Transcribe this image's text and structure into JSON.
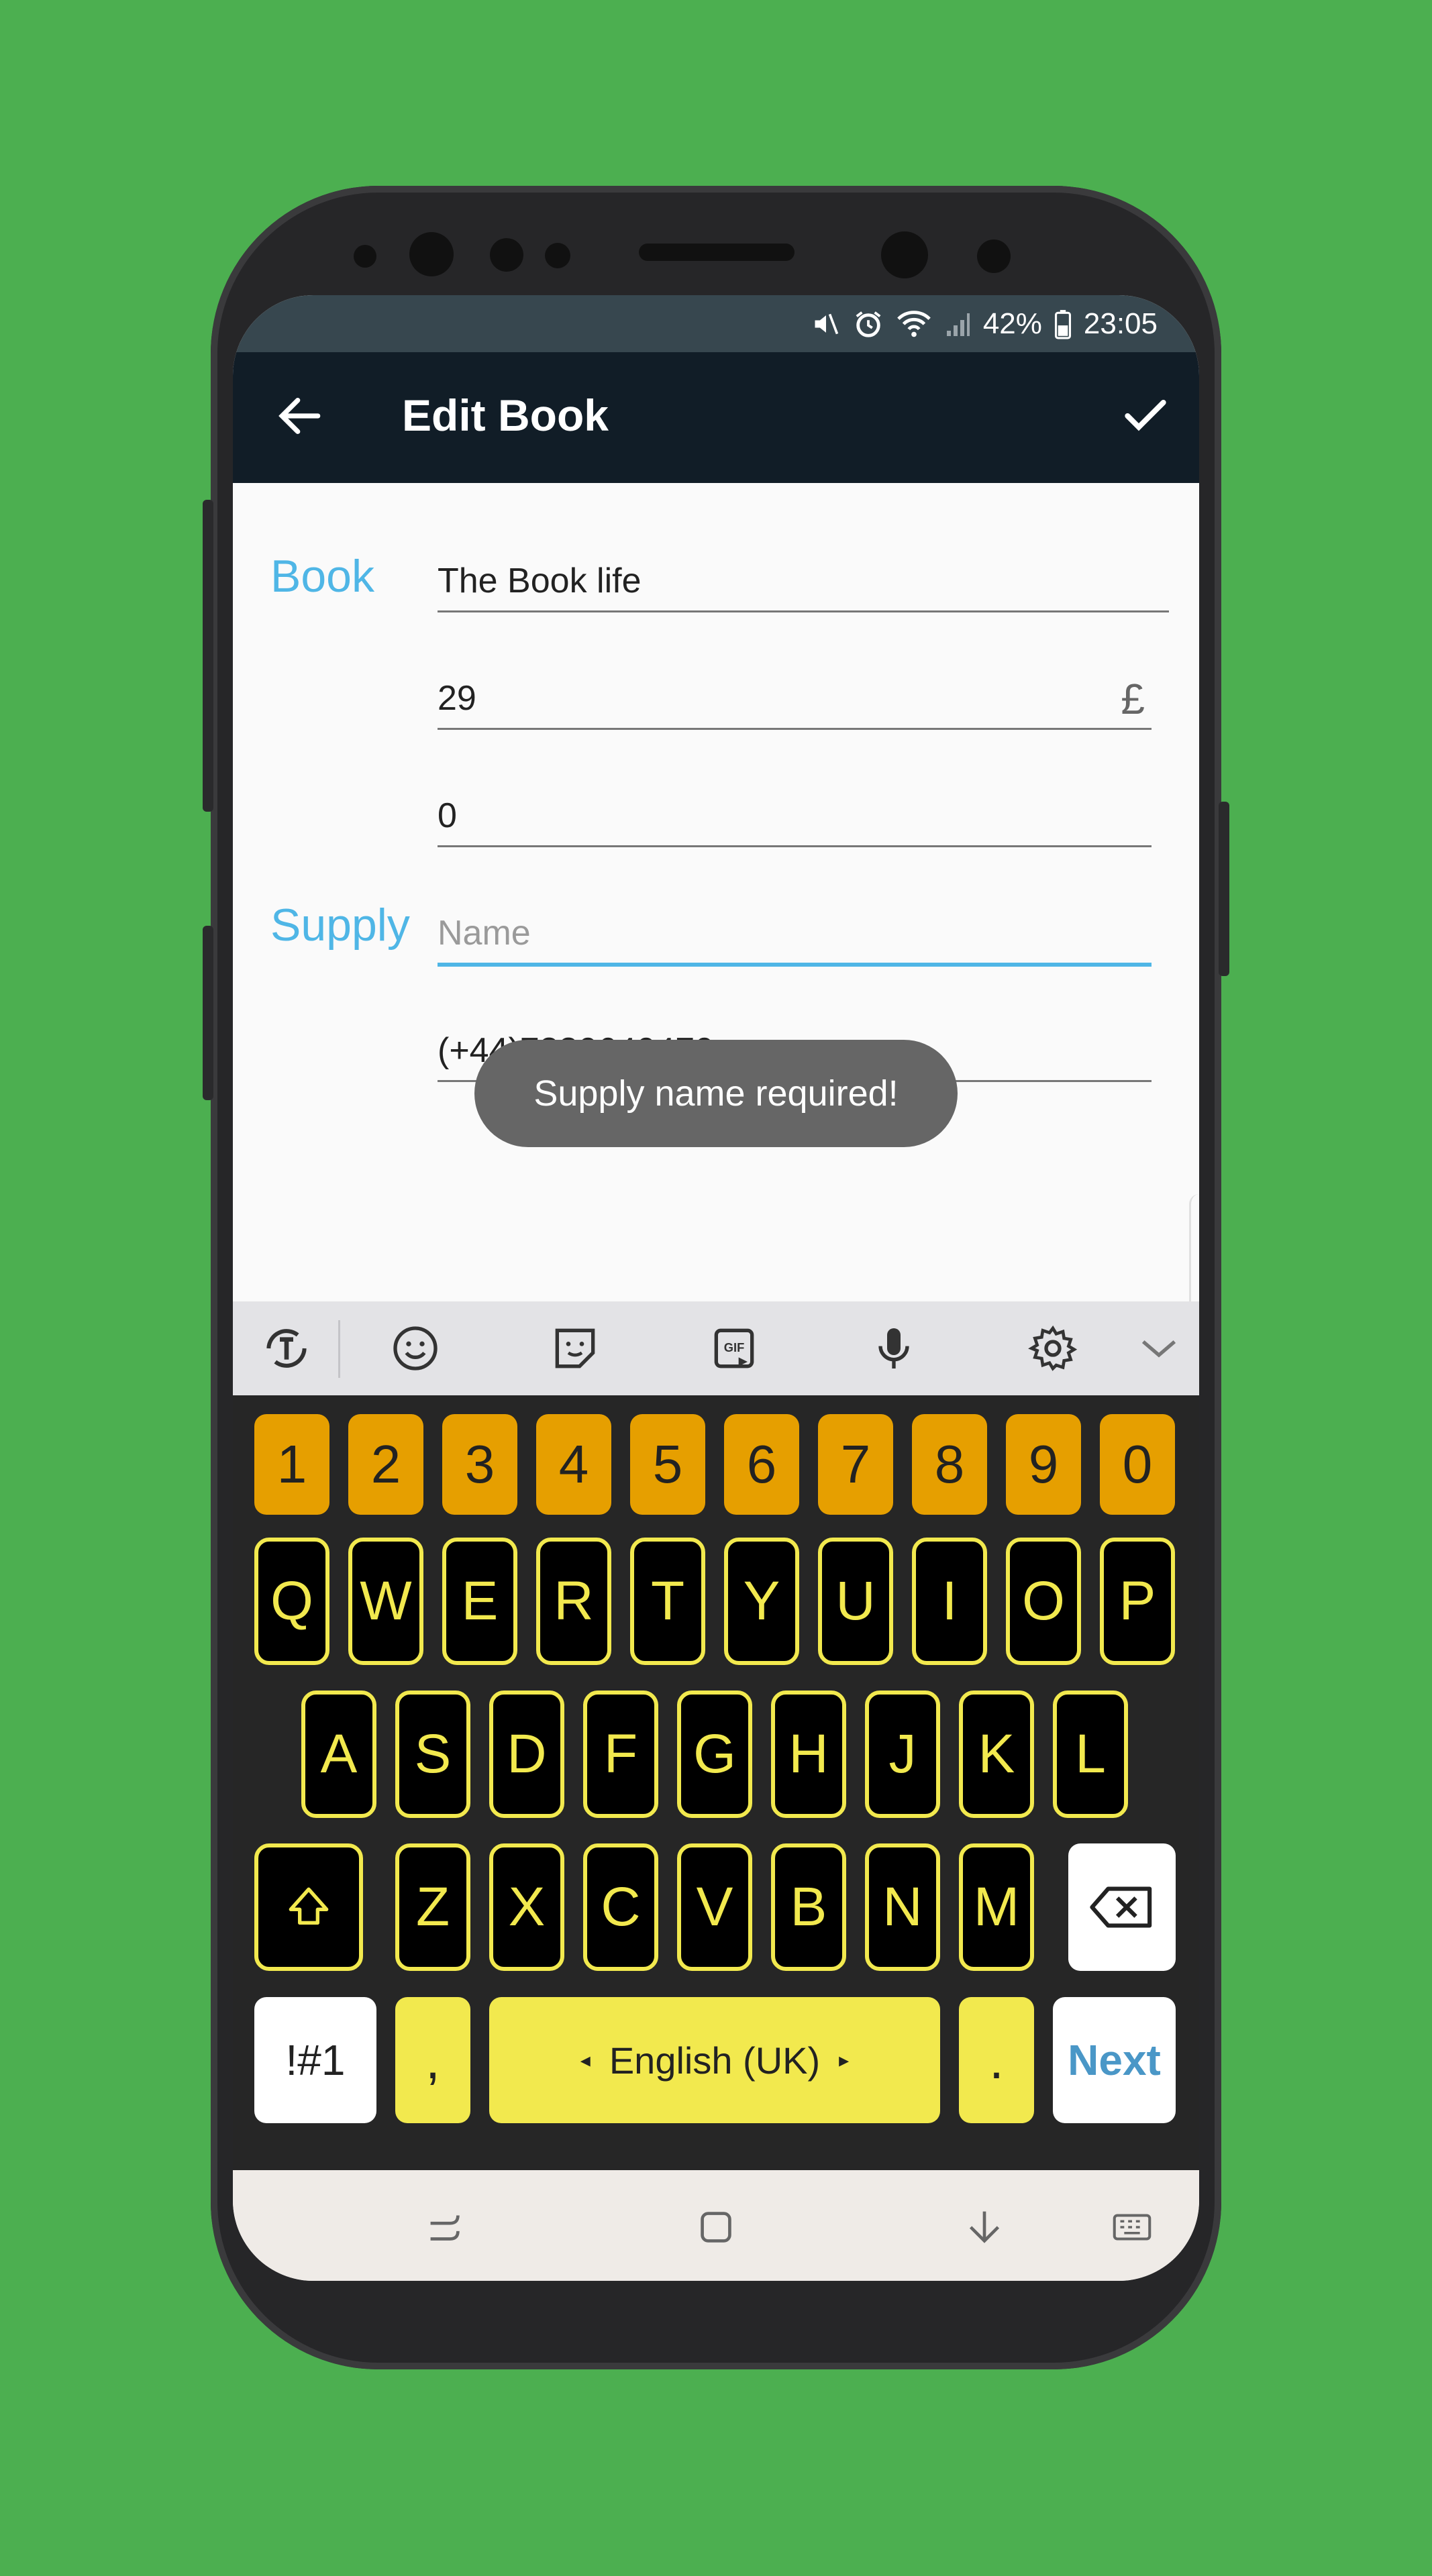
{
  "status": {
    "battery": "42%",
    "time": "23:05",
    "icons": [
      "mute-icon",
      "alarm-icon",
      "wifi-icon",
      "signal-icon",
      "battery-icon"
    ]
  },
  "appbar": {
    "title": "Edit Book",
    "back_icon": "arrow-left-icon",
    "confirm_icon": "checkmark-icon"
  },
  "form": {
    "book_label": "Book",
    "book_name": "The Book life",
    "price": "29",
    "currency": "£",
    "quantity": "0",
    "supply_label": "Supply",
    "supply_name_placeholder": "Name",
    "supply_phone": "(+44)7880640470"
  },
  "toast": {
    "message": "Supply name required!"
  },
  "keyboard_toolbar": {
    "icons": [
      "text-mode-icon",
      "emoji-icon",
      "sticker-icon",
      "gif-icon",
      "microphone-icon",
      "settings-icon",
      "collapse-chevron-icon"
    ]
  },
  "keyboard": {
    "numbers": [
      "1",
      "2",
      "3",
      "4",
      "5",
      "6",
      "7",
      "8",
      "9",
      "0"
    ],
    "row1": [
      "Q",
      "W",
      "E",
      "R",
      "T",
      "Y",
      "U",
      "I",
      "O",
      "P"
    ],
    "row2": [
      "A",
      "S",
      "D",
      "F",
      "G",
      "H",
      "J",
      "K",
      "L"
    ],
    "row3": [
      "Z",
      "X",
      "C",
      "V",
      "B",
      "N",
      "M"
    ],
    "symbols_label": "!#1",
    "comma": ",",
    "space_label": "English (UK)",
    "period": ".",
    "next_label": "Next",
    "colors": {
      "number_key": "#e69f00",
      "letter_text": "#f2e94e",
      "letter_bg": "#000000",
      "next_text": "#4a97c7"
    }
  },
  "navbar": {
    "icons": [
      "recent-apps-icon",
      "home-icon",
      "hide-keyboard-icon",
      "keyboard-switch-icon"
    ]
  },
  "colors": {
    "background": "#4caf50",
    "appbar": "#111d27",
    "accent": "#4fb6e6",
    "statusbar": "#37474f"
  }
}
